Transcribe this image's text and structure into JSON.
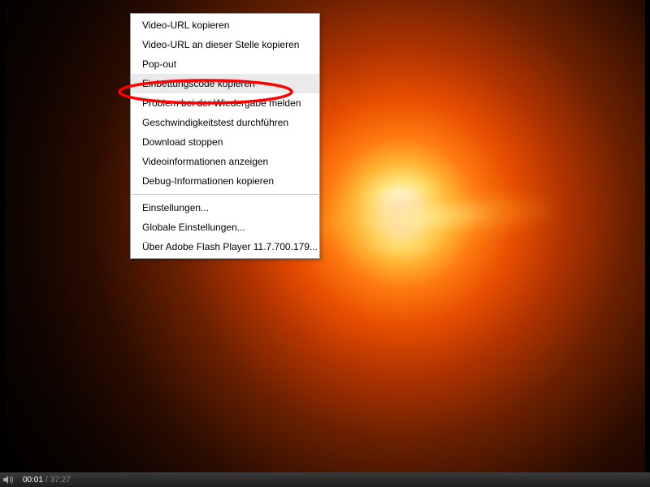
{
  "menu": {
    "group1": [
      "Video-URL kopieren",
      "Video-URL an dieser Stelle kopieren",
      "Pop-out",
      "Einbettungscode kopieren",
      "Problem bei der Wiedergabe melden",
      "Geschwindigkeitstest durchführen",
      "Download stoppen",
      "Videoinformationen anzeigen",
      "Debug-Informationen kopieren"
    ],
    "group2": [
      "Einstellungen...",
      "Globale Einstellungen...",
      "Über Adobe Flash Player 11.7.700.179..."
    ],
    "highlighted_index": 3
  },
  "controls": {
    "current_time": "00:01",
    "total_time": "37:27",
    "time_sep": "/"
  },
  "annotation": {
    "ellipse_color": "#ff0000"
  }
}
